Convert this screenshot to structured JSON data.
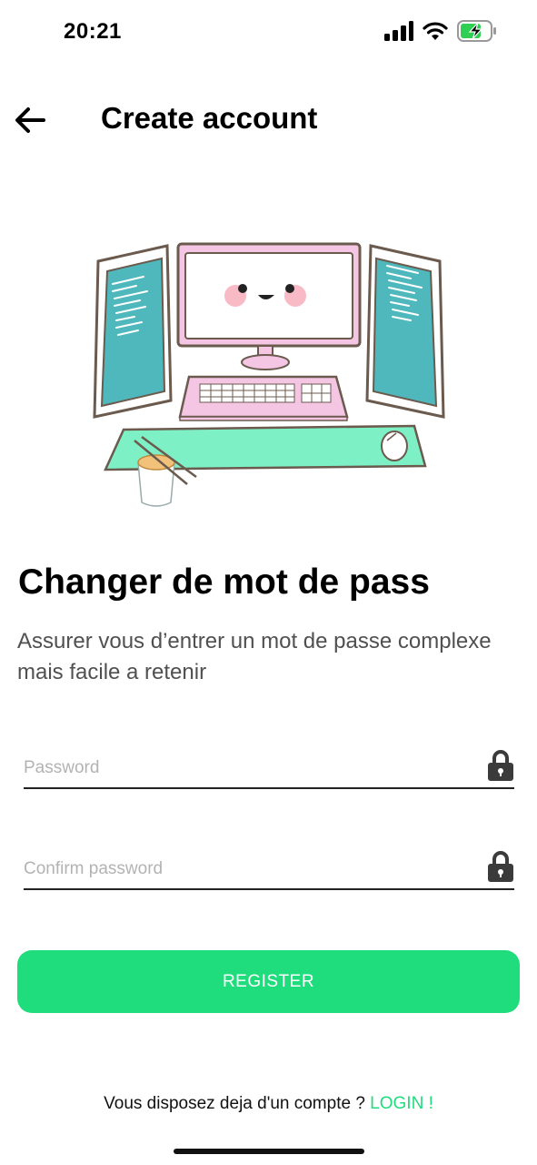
{
  "status_bar": {
    "time": "20:21",
    "icons": [
      "signal-icon",
      "wifi-icon",
      "battery-charging-icon"
    ]
  },
  "header": {
    "back_icon": "arrow-left-icon",
    "title": "Create account"
  },
  "illustration": {
    "description_icon": "computer-setup-illustration"
  },
  "content": {
    "heading": "Changer de mot de pass",
    "subtext_line1": "Assurer vous d’entrer un mot de passe complexe",
    "subtext_line2": "mais facile a retenir"
  },
  "form": {
    "password_placeholder": "Password",
    "confirm_placeholder": "Confirm password",
    "lock_icon": "lock-icon",
    "register_label": "REGISTER"
  },
  "footer": {
    "prompt": "Vous disposez deja d'un compte ? ",
    "login_label": "LOGIN !"
  },
  "colors": {
    "accent": "#1fdc7c",
    "monitor_pink": "#f4c6e4",
    "screen_teal": "#4fb8bd",
    "desk_mint": "#7ef0c6"
  }
}
